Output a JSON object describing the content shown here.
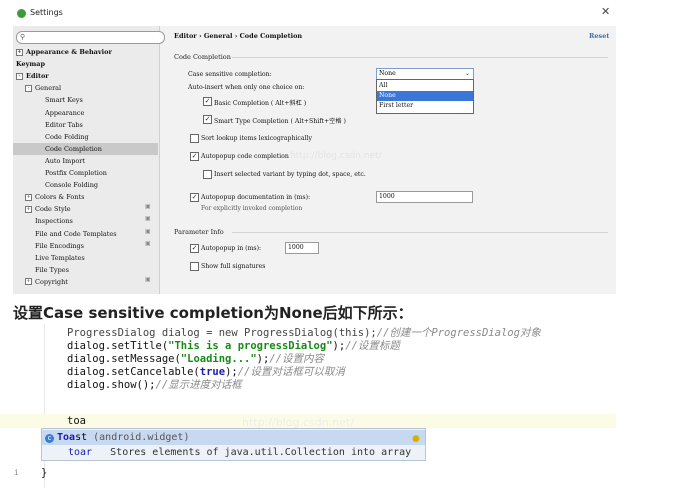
{
  "window": {
    "title": "Settings",
    "close_glyph": "✕"
  },
  "search": {
    "placeholder": "",
    "icon": "search-icon"
  },
  "tree": [
    {
      "label": "Appearance & Behavior",
      "expander": "+",
      "bold": true
    },
    {
      "label": "Keymap",
      "bold": true
    },
    {
      "label": "Editor",
      "expander": "-",
      "bold": true
    },
    {
      "label": "General",
      "expander": "-"
    },
    {
      "label": "Smart Keys"
    },
    {
      "label": "Appearance"
    },
    {
      "label": "Editor Tabs"
    },
    {
      "label": "Code Folding"
    },
    {
      "label": "Code Completion",
      "selected": true
    },
    {
      "label": "Auto Import"
    },
    {
      "label": "Postfix Completion"
    },
    {
      "label": "Console Folding"
    },
    {
      "label": "Colors & Fonts",
      "expander": "+"
    },
    {
      "label": "Code Style",
      "expander": "+",
      "project_icon": true
    },
    {
      "label": "Inspections",
      "project_icon": true
    },
    {
      "label": "File and Code Templates",
      "project_icon": true
    },
    {
      "label": "File Encodings",
      "project_icon": true
    },
    {
      "label": "Live Templates"
    },
    {
      "label": "File Types"
    },
    {
      "label": "Copyright",
      "expander": "+",
      "project_icon": true
    }
  ],
  "breadcrumb": "Editor › General › Code Completion",
  "reset_label": "Reset",
  "sections": {
    "code_completion": "Code Completion",
    "parameter_info": "Parameter Info"
  },
  "case_sensitive": {
    "label": "Case sensitive completion:",
    "value": "None",
    "options": [
      "All",
      "None",
      "First letter"
    ],
    "selected_index": 1
  },
  "auto_insert_label": "Auto-insert when only one choice on:",
  "basic_completion": {
    "label": "Basic Completion ( Alt+斜杠 )",
    "checked": true
  },
  "smart_completion": {
    "label": "Smart Type Completion ( Alt+Shift+空格 )",
    "checked": true
  },
  "sort_lexico": {
    "label": "Sort lookup items lexicographically",
    "checked": false
  },
  "autopopup_code": {
    "label": "Autopopup code completion",
    "checked": true
  },
  "insert_selected": {
    "label": "Insert selected variant by typing dot, space, etc.",
    "checked": false
  },
  "autopopup_doc": {
    "label": "Autopopup documentation in (ms):",
    "checked": true,
    "value": "1000",
    "hint": "For explicitly invoked completion"
  },
  "param_autopopup": {
    "label": "Autopopup in (ms):",
    "checked": true,
    "value": "1000"
  },
  "show_full_signatures": {
    "label": "Show full signatures",
    "checked": false
  },
  "check_glyph": "✓",
  "watermark": "http://blog.csdn.net/",
  "caption": "设置Case sensitive completion为None后如下所示：",
  "code": {
    "line0": {
      "code": "ProgressDialog dialog = new ProgressDialog(this);",
      "comment": "//创建一个ProgressDialog对象"
    },
    "line1": {
      "pre": "dialog.setTitle(",
      "str": "\"This is a progressDialog\"",
      "post": ");",
      "comment": "//设置标题"
    },
    "line2": {
      "pre": "dialog.setMessage(",
      "str": "\"Loading...\"",
      "post": ");",
      "comment": "//设置内容"
    },
    "line3": {
      "pre": "dialog.setCancelable(",
      "kw": "true",
      "post": ");",
      "comment": "//设置对话框可以取消"
    },
    "line4": {
      "pre": "dialog.show();",
      "comment": "//显示进度对话框"
    },
    "typed": "toa",
    "closing_brace": "}",
    "gutter_mark": "i"
  },
  "autocomplete": [
    {
      "icon": "c",
      "match": "Toa",
      "rest": "st",
      "pkg": " (android.widget)",
      "selected": true
    },
    {
      "name": "toar",
      "desc": "Stores elements of java.util.Collection into array",
      "selected": false
    }
  ]
}
